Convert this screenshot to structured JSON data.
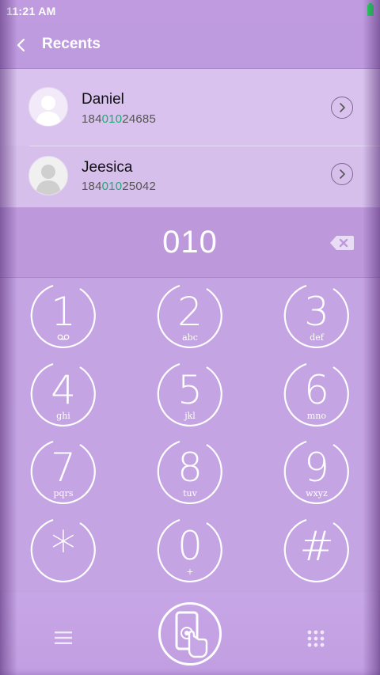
{
  "status": {
    "time": "11:21 AM",
    "battery_color": "#22d85a"
  },
  "header": {
    "title": "Recents",
    "back_icon": "chevron-left-icon"
  },
  "recents": [
    {
      "name": "Daniel",
      "number_prefix": "184",
      "number_match": "010",
      "number_suffix": "24685"
    },
    {
      "name": "Jeesica",
      "number_prefix": "184",
      "number_match": "010",
      "number_suffix": "25042"
    }
  ],
  "dial": {
    "number": "010",
    "backspace_icon": "backspace-icon"
  },
  "keys": [
    {
      "digit": "1",
      "letters": ""
    },
    {
      "digit": "2",
      "letters": "abc"
    },
    {
      "digit": "3",
      "letters": "def"
    },
    {
      "digit": "4",
      "letters": "ghi"
    },
    {
      "digit": "5",
      "letters": "jkl"
    },
    {
      "digit": "6",
      "letters": "mno"
    },
    {
      "digit": "7",
      "letters": "pqrs"
    },
    {
      "digit": "8",
      "letters": "tuv"
    },
    {
      "digit": "9",
      "letters": "wxyz"
    },
    {
      "digit": "*",
      "letters": ""
    },
    {
      "digit": "0",
      "letters": "+"
    },
    {
      "digit": "#",
      "letters": ""
    }
  ],
  "bottom": {
    "menu_icon": "menu-icon",
    "call_icon": "phone-touch-icon",
    "keypad_icon": "dialpad-icon"
  },
  "colors": {
    "accent": "#c29ee0",
    "match_highlight": "#1ea971"
  }
}
